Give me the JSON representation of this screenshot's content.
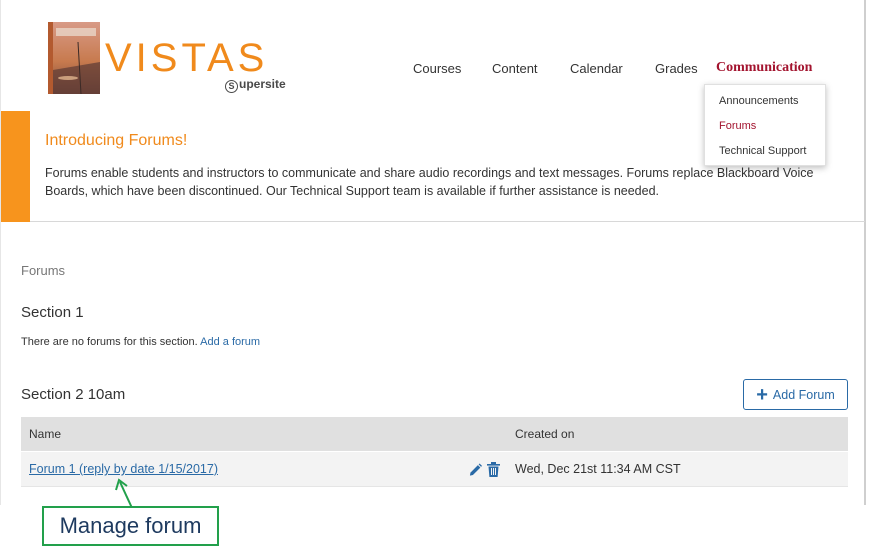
{
  "brand": {
    "logo_text": "VISTAS",
    "super_site": "upersite",
    "super_s": "S",
    "book_cover_text": "VISTAS"
  },
  "nav": {
    "items": [
      "Courses",
      "Content",
      "Calendar",
      "Grades",
      "Communication"
    ],
    "active": "Communication"
  },
  "dropdown": {
    "items": [
      "Announcements",
      "Forums",
      "Technical Support"
    ],
    "active": "Forums"
  },
  "announcement": {
    "title": "Introducing Forums!",
    "body": "Forums enable students and instructors to communicate and share audio recordings and text messages. Forums replace Blackboard Voice Boards, which have been discontinued. Our Technical Support team is available if further assistance is needed."
  },
  "page": {
    "breadcrumb": "Forums",
    "section1": {
      "title": "Section 1",
      "empty_message": "There are no forums for this section.",
      "add_link": "Add a forum"
    },
    "section2": {
      "title": "Section 2 10am",
      "add_button": "Add Forum",
      "columns": [
        "Name",
        "Created on"
      ],
      "rows": [
        {
          "name": "Forum 1 (reply by date 1/15/2017)",
          "created": "Wed, Dec 21st 11:34 AM CST"
        }
      ]
    }
  },
  "callout": {
    "label": "Manage forum"
  },
  "colors": {
    "accent_orange": "#f7941d",
    "active_red": "#a3142f",
    "link_blue": "#2a6aa6",
    "callout_green": "#22a04b"
  },
  "icons": [
    "pencil-icon",
    "trash-icon",
    "plus-icon"
  ]
}
